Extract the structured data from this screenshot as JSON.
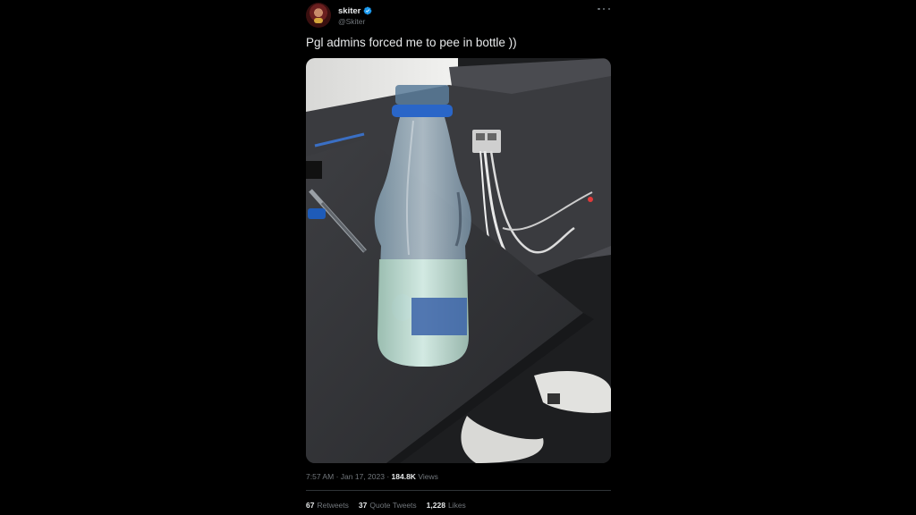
{
  "tweet": {
    "display_name": "skiter",
    "handle": "@Skiter",
    "verified_icon": "verified-badge-icon",
    "more_icon": "more-dots-icon",
    "text": "Pgl admins forced me to pee in bottle ))",
    "time": "7:57 AM",
    "separator": "·",
    "date": "Jan 17, 2023",
    "views_count": "184.8K",
    "views_label": "Views",
    "retweets_count": "67",
    "retweets_label": "Retweets",
    "quotes_count": "37",
    "quotes_label": "Quote Tweets",
    "likes_count": "1,228",
    "likes_label": "Likes",
    "accent_color": "#1d9bf0",
    "background_color": "#000000"
  }
}
